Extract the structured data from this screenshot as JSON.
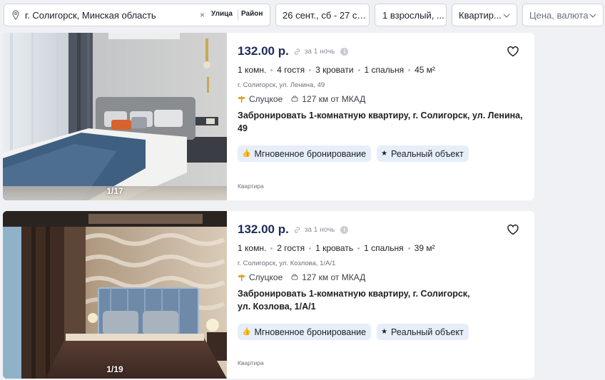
{
  "filters": {
    "location": "г. Солигорск, Минская область",
    "clear": "×",
    "street_chip": "Улица",
    "district_chip": "Район",
    "dates": "26 сент., сб - 27 се...",
    "guests": "1 взрослый, ...",
    "property_type": "Квартир...",
    "price": "Цена, валюта"
  },
  "listings": [
    {
      "photo_counter": "1/17",
      "price": "132.00 р.",
      "per_night": "за 1 ночь",
      "info": "i",
      "specs": [
        "1 комн.",
        "4 гостя",
        "3 кровати",
        "1 спальня",
        "45 м²"
      ],
      "address": "г. Солигорск, ул. Ленина, 49",
      "city": "Слуцкое",
      "distance": "127 км от МКАД",
      "title": "Забронировать 1-комнатную квартиру, г. Солигорск, ул. Ленина, 49",
      "badge_instant": "Мгновенное бронирование",
      "badge_real": "Реальный объект",
      "category": "Квартира"
    },
    {
      "photo_counter": "1/19",
      "price": "132.00 р.",
      "per_night": "за 1 ночь",
      "info": "i",
      "specs": [
        "1 комн.",
        "2 гостя",
        "1 кровать",
        "1 спальня",
        "39 м²"
      ],
      "address": "г. Солигорск, ул. Козлова, 1/А/1",
      "city": "Слуцкое",
      "distance": "127 км от МКАД",
      "title": "Забронировать 1-комнатную квартиру, г. Солигорск, ул. Козлова, 1/А/1",
      "badge_instant": "Мгновенное бронирование",
      "badge_real": "Реальный объект",
      "category": "Квартира"
    }
  ],
  "colors": {
    "price": "#1e2a5a",
    "badge_bg": "#e6eef9",
    "page_bg": "#eff1f4"
  },
  "icons": [
    "location-pin-icon",
    "chevron-down-icon",
    "heart-icon",
    "link-icon",
    "info-icon",
    "signpost-icon",
    "car-icon",
    "thumbs-up-icon",
    "star-icon"
  ]
}
